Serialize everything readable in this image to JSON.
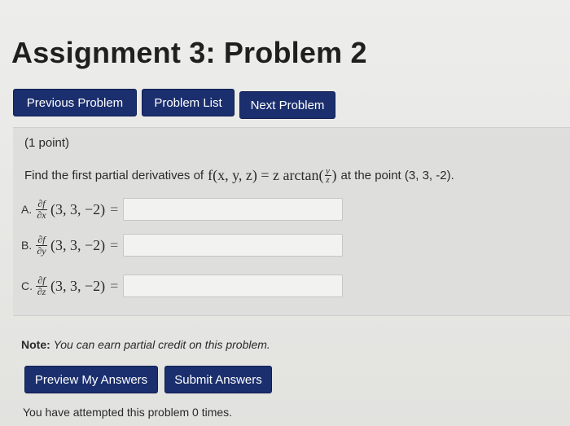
{
  "page": {
    "title": "Assignment 3: Problem 2"
  },
  "nav": {
    "previous_label": "Previous Problem",
    "list_label": "Problem List",
    "next_label": "Next Problem"
  },
  "problem": {
    "points": "(1 point)",
    "prompt_prefix": "Find the first partial derivatives of",
    "function_lhs": "f(x, y, z) = z arctan(",
    "arctan_num": "y",
    "arctan_den": "z",
    "function_close": ")",
    "prompt_suffix": "at the point (3, 3, -2).",
    "parts": [
      {
        "letter": "A.",
        "num": "∂f",
        "den": "∂x",
        "point": "(3, 3, −2)",
        "eq": "=",
        "value": ""
      },
      {
        "letter": "B.",
        "num": "∂f",
        "den": "∂y",
        "point": "(3, 3, −2)",
        "eq": "=",
        "value": ""
      },
      {
        "letter": "C.",
        "num": "∂f",
        "den": "∂z",
        "point": "(3, 3, −2)",
        "eq": "=",
        "value": ""
      }
    ]
  },
  "note": {
    "label": "Note:",
    "text": "You can earn partial credit on this problem."
  },
  "actions": {
    "preview_label": "Preview My Answers",
    "submit_label": "Submit Answers"
  },
  "attempts": {
    "text": "You have attempted this problem 0 times."
  }
}
